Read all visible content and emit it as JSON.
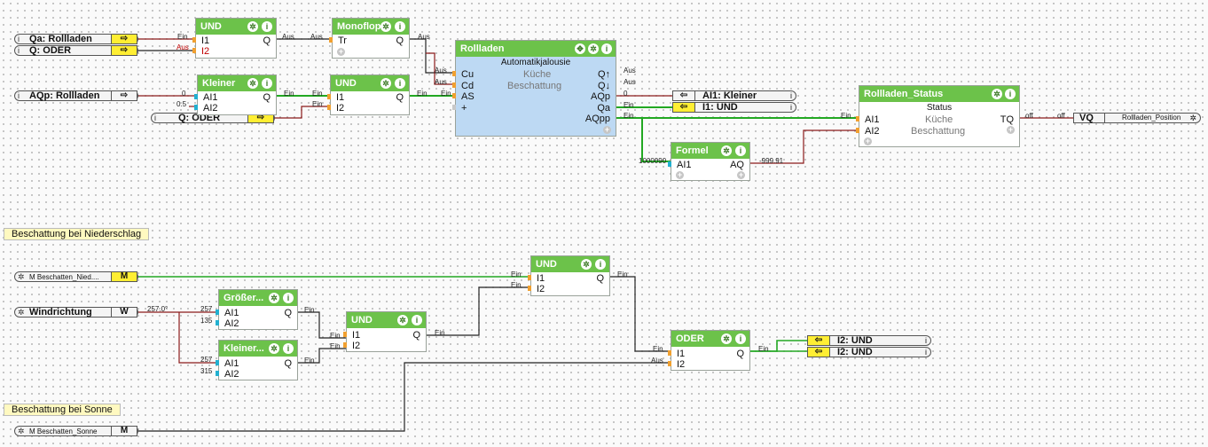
{
  "blocks": {
    "und1": {
      "title": "UND",
      "in1": "I1",
      "in2": "I2",
      "out": "Q"
    },
    "monoflop": {
      "title": "Monoflop",
      "in1": "Tr",
      "out": "Q"
    },
    "kleiner1": {
      "title": "Kleiner",
      "in1": "AI1",
      "in2": "AI2",
      "out": "Q"
    },
    "und2": {
      "title": "UND",
      "in1": "I1",
      "in2": "I2",
      "out": "Q"
    },
    "rollladen": {
      "title": "Rollladen",
      "subtitle": "Automatikjalousie",
      "mid1": "Küche",
      "mid2": "Beschattung",
      "in1": "Cu",
      "in2": "Cd",
      "in3": "AS",
      "in4": "+",
      "out1": "Q↑",
      "out2": "Q↓",
      "out3": "AQp",
      "out4": "Qa",
      "out5": "AQpp"
    },
    "formel": {
      "title": "Formel",
      "in1": "AI1",
      "out": "AQ"
    },
    "status": {
      "title": "Rollladen_Status",
      "subtitle": "Status",
      "mid1": "Küche",
      "mid2": "Beschattung",
      "in1": "AI1",
      "in2": "AI2",
      "out": "TQ"
    },
    "und3": {
      "title": "UND",
      "in1": "I1",
      "in2": "I2",
      "out": "Q"
    },
    "groesser": {
      "title": "Größer...",
      "in1": "AI1",
      "in2": "AI2",
      "out": "Q"
    },
    "und4": {
      "title": "UND",
      "in1": "I1",
      "in2": "I2",
      "out": "Q"
    },
    "kleiner2": {
      "title": "Kleiner...",
      "in1": "AI1",
      "in2": "AI2",
      "out": "Q"
    },
    "oder": {
      "title": "ODER",
      "in1": "I1",
      "in2": "I2",
      "out": "Q"
    }
  },
  "connectors": {
    "qa": {
      "label": "Qa: Rollladen"
    },
    "qoder": {
      "label": "Q: ODER"
    },
    "aqp": {
      "label": "AQp: Rollladen"
    },
    "qoder2": {
      "label": "Q: ODER"
    },
    "ai1kleiner": {
      "label": "AI1: Kleiner"
    },
    "i1und": {
      "label": "I1: UND"
    },
    "vq": {
      "label": "VQ",
      "value": "Rollladen_Position"
    },
    "mNied": {
      "label": "M Beschatten_Nied....",
      "box": "M"
    },
    "windrichtung": {
      "label": "Windrichtung",
      "box": "W"
    },
    "i2und1": {
      "label": "I2: UND"
    },
    "i2und2": {
      "label": "I2: UND"
    },
    "mSonne": {
      "label": "M Beschatten_Sonne",
      "box": "M"
    }
  },
  "comments": {
    "niederschlag": "Beschattung bei Niederschlag",
    "sonne": "Beschattung bei Sonne"
  },
  "wire_labels": {
    "ein": "Ein",
    "aus": "Aus",
    "off": "off",
    "zero": "0",
    "half": "0.5",
    "v1000090": "1000090",
    "v99991": "-999.91",
    "v2570": "257.0°",
    "v257": "257",
    "v135": "135",
    "v315": "315"
  },
  "colors": {
    "header": "#6cc24a",
    "blue_body": "#bdd9f3",
    "yellow": "#ffee33",
    "wire_green": "#22a822",
    "wire_dark": "#8b1a1a",
    "comment_bg": "#fff9c0"
  }
}
